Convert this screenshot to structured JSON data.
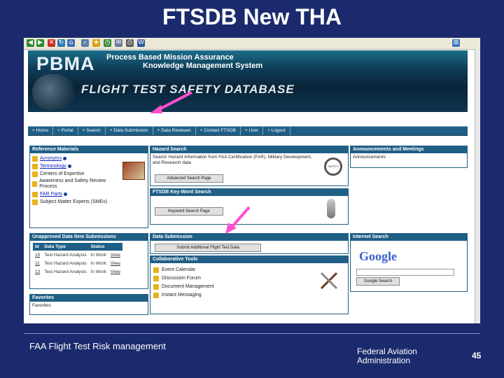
{
  "slide": {
    "title": "FTSDB New THA",
    "footer_left": "FAA  Flight Test Risk management",
    "footer_org_line1": "Federal Aviation",
    "footer_org_line2": "Administration",
    "page_number": "45"
  },
  "banner": {
    "logo": "PBMA",
    "subtitle_line1": "Process Based Mission Assurance",
    "subtitle_line2": "Knowledge Management System",
    "database_title": "FLIGHT TEST SAFETY DATABASE"
  },
  "nav": {
    "items": [
      "+ Home",
      "+ Portal",
      "+ Search",
      "+ Data Submission",
      "+ Data Reviewer",
      "+ Contact FTSDB",
      "+ User",
      "+ Logout"
    ]
  },
  "reference": {
    "title": "Reference Materials",
    "items": [
      "Acronyms",
      "Terminology",
      "Centers of Expertise",
      "Awareness and Safety Review Process",
      "FAR Parts",
      "Subject Matter Experts (SMEs)"
    ]
  },
  "hazard_search": {
    "title": "Hazard Search",
    "text": "Search Hazard Information from FAA Certification (FAR), Military Development, and Research data",
    "button": "Advanced Search Page"
  },
  "keyword_search": {
    "title": "FTSDB Key-Word Search",
    "button": "Keyword Search Page"
  },
  "announcements": {
    "title": "Announcements and Meetings",
    "item": "Announcements"
  },
  "unapproved": {
    "title": "Unapproved Data Item Submissions",
    "headers": [
      "Id",
      "Data Type",
      "Status",
      ""
    ],
    "rows": [
      [
        "10",
        "Test Hazard Analysis",
        "In Work",
        "View"
      ],
      [
        "11",
        "Test Hazard Analysis",
        "In Work",
        "View"
      ],
      [
        "13",
        "Test Hazard Analysis",
        "In Work",
        "View"
      ]
    ]
  },
  "data_submission": {
    "title": "Data Submission",
    "button": "Submit Additional Flight Test Data"
  },
  "collaborative": {
    "title": "Collaborative Tools",
    "items": [
      "Event Calendar",
      "Discussion Forum",
      "Document Management",
      "Instant Messaging"
    ]
  },
  "internet_search": {
    "title": "Internet Search",
    "logo": "Google",
    "button": "Google Search"
  },
  "favorites": {
    "title": "Favorites",
    "item": "Favorites"
  },
  "colors": {
    "slide_bg": "#1a2a6c",
    "panel_header": "#1f5f86",
    "arrow": "#ff4fd0"
  }
}
